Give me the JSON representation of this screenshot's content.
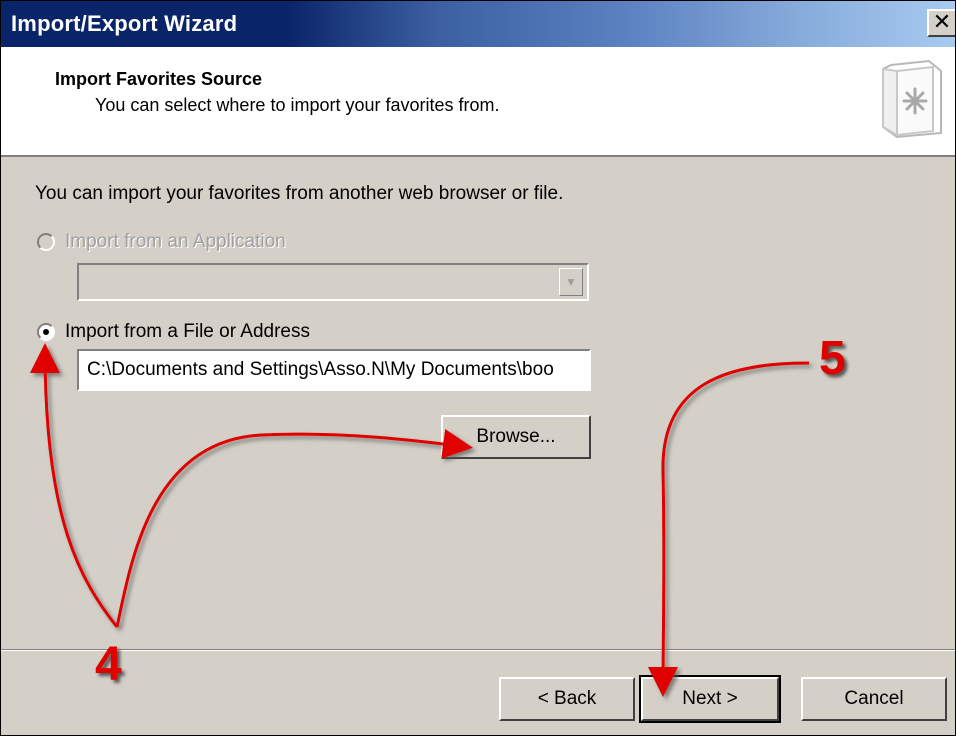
{
  "window": {
    "title": "Import/Export Wizard",
    "close_label": "✕"
  },
  "header": {
    "title": "Import Favorites Source",
    "subtitle": "You can select where to import your favorites from.",
    "icon": "favorites-book-icon"
  },
  "content": {
    "intro": "You can import your favorites from another web browser or file.",
    "option_application": {
      "label": "Import from an Application",
      "selected": false,
      "enabled": false
    },
    "application_dropdown": {
      "value": ""
    },
    "option_file": {
      "label": "Import from a File or Address",
      "selected": true,
      "enabled": true
    },
    "path_input": {
      "value": "C:\\Documents and Settings\\Asso.N\\My Documents\\boo"
    },
    "browse_label": "Browse..."
  },
  "footer": {
    "back_label": "< Back",
    "next_label": "Next >",
    "cancel_label": "Cancel"
  },
  "annotations": {
    "step4_label": "4",
    "step5_label": "5",
    "arrow_color": "#e00000"
  }
}
